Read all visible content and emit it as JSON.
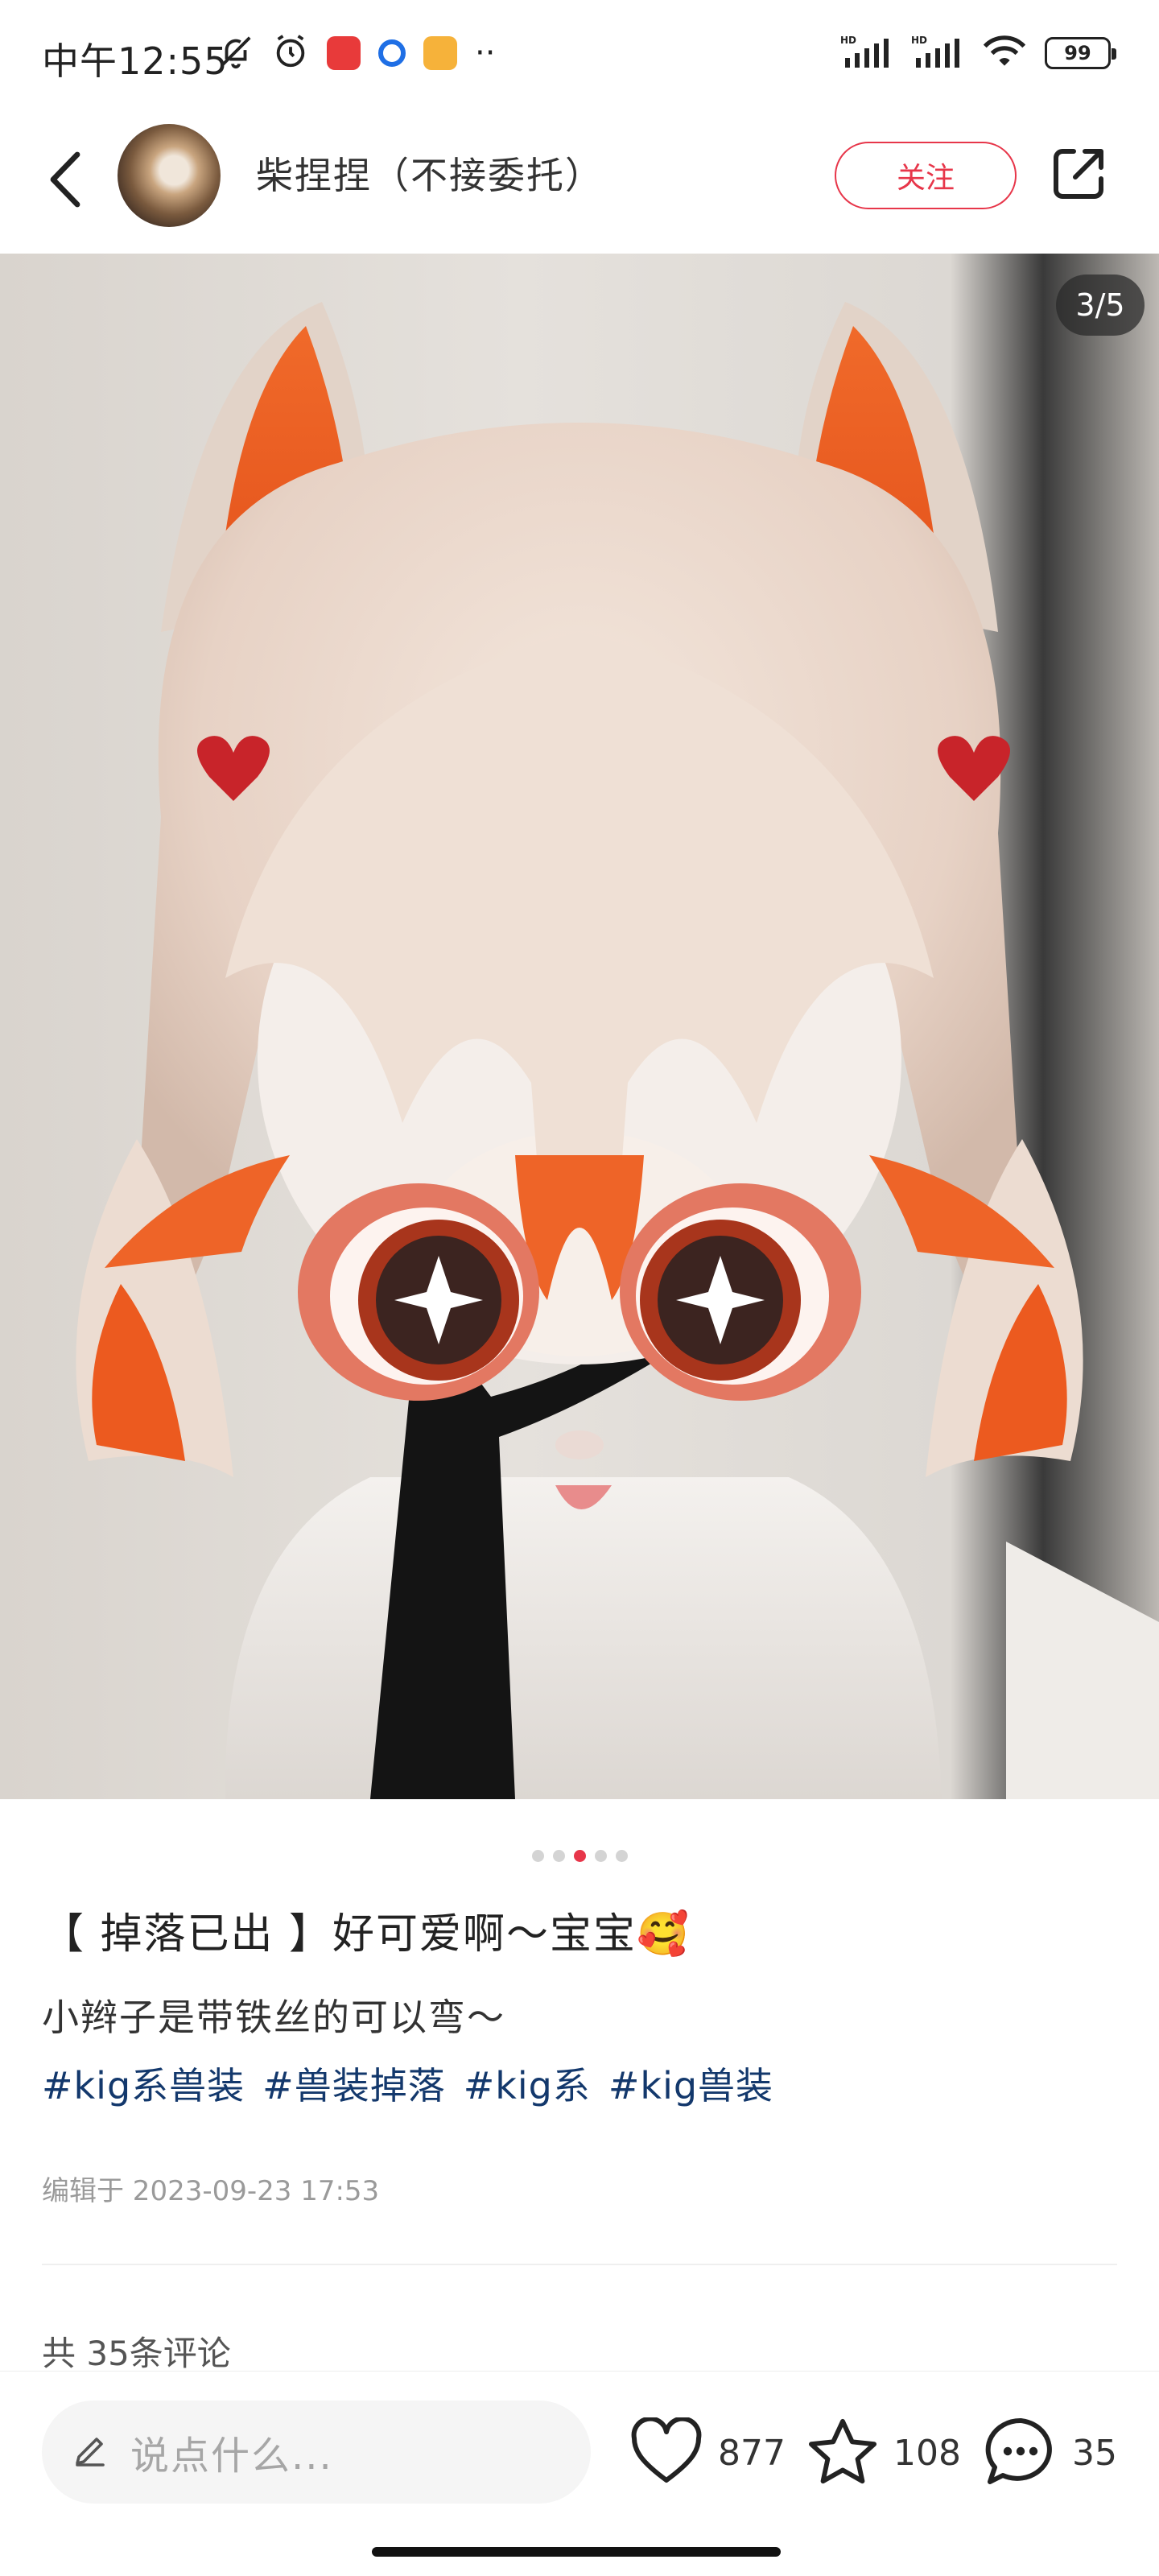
{
  "status_bar": {
    "time": "中午12:55",
    "battery": "99"
  },
  "header": {
    "author_name": "柴捏捏（不接委托）",
    "follow_label": "关注"
  },
  "image": {
    "page_indicator": "3/5",
    "current_page": 3,
    "total_pages": 5
  },
  "post": {
    "title": "【 掉落已出 】好可爱啊～宝宝🥰",
    "description": "小辫子是带铁丝的可以弯～",
    "tags": [
      "#kig系兽装",
      "#兽装掉落",
      "#kig系",
      "#kig兽装"
    ],
    "edit_time": "编辑于 2023-09-23 17:53"
  },
  "comments": {
    "count_label": "共 35条评论"
  },
  "bottom_bar": {
    "input_placeholder": "说点什么...",
    "likes": "877",
    "collects": "108",
    "comments": "35"
  },
  "colors": {
    "accent": "#e7364a",
    "tag": "#13386c"
  },
  "icons": [
    "bell-off-icon",
    "alarm-icon",
    "wifi-icon",
    "signal-icon",
    "back-icon",
    "share-icon",
    "edit-icon",
    "heart-icon",
    "star-icon",
    "comment-icon"
  ]
}
